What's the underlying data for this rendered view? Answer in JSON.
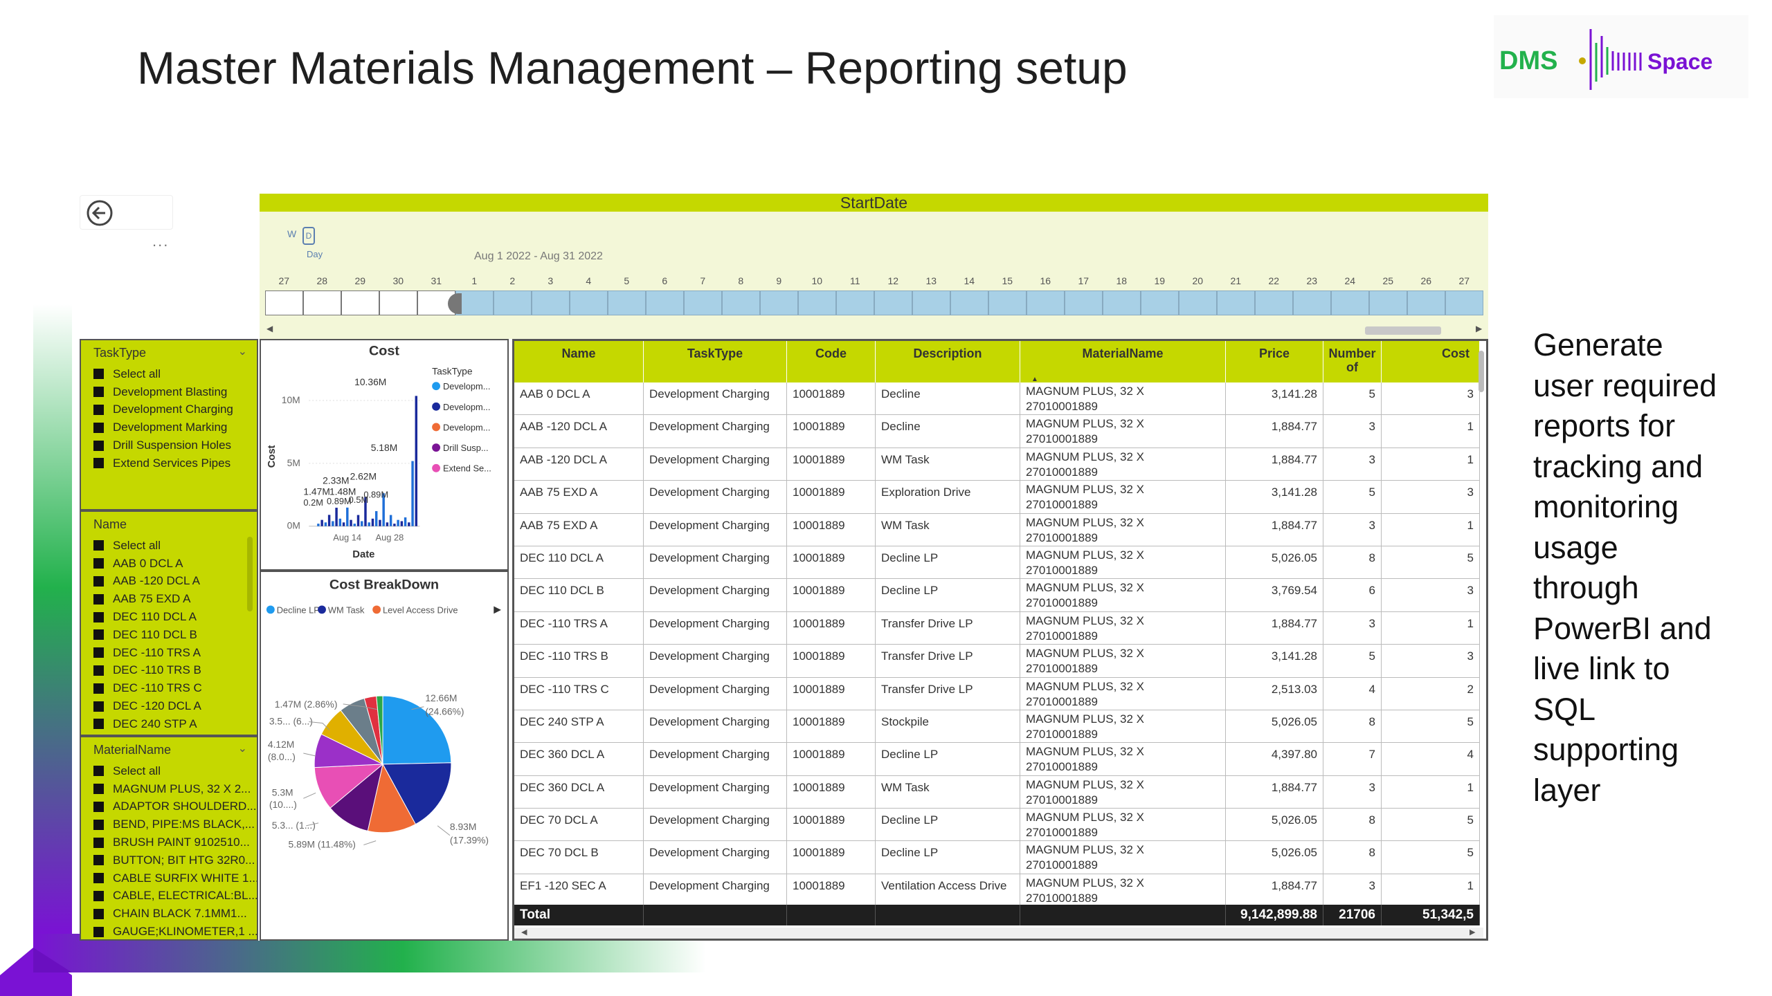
{
  "slide": {
    "title": "Master Materials Management – Reporting setup",
    "logo_dms": "DMS",
    "logo_space": "Space",
    "side_text_lines": [
      "Generate",
      "user required",
      "reports for",
      "tracking and",
      "monitoring",
      "usage",
      "through",
      "PowerBI and",
      "live link to",
      "SQL",
      "supporting",
      "layer"
    ]
  },
  "report": {
    "back_icon": "back-arrow-icon",
    "more_options": "...",
    "timeline": {
      "header": "StartDate",
      "granularity_w": "W",
      "granularity_d": "D",
      "granularity_label": "Day",
      "date_range": "Aug 1 2022 - Aug 31 2022",
      "days": [
        "27",
        "28",
        "29",
        "30",
        "31",
        "1",
        "2",
        "3",
        "4",
        "5",
        "6",
        "7",
        "8",
        "9",
        "10",
        "11",
        "12",
        "13",
        "14",
        "15",
        "16",
        "17",
        "18",
        "19",
        "20",
        "21",
        "22",
        "23",
        "24",
        "25",
        "26",
        "27"
      ],
      "selected_start_index": 5
    },
    "slicers": {
      "tasktype": {
        "title": "TaskType",
        "items": [
          "Select all",
          "Development Blasting",
          "Development Charging",
          "Development Marking",
          "Drill Suspension Holes",
          "Extend Services Pipes"
        ]
      },
      "name": {
        "title": "Name",
        "items": [
          "Select all",
          "AAB 0 DCL A",
          "AAB -120 DCL A",
          "AAB 75 EXD A",
          "DEC 110 DCL A",
          "DEC 110 DCL B",
          "DEC -110 TRS A",
          "DEC -110 TRS B",
          "DEC -110 TRS C",
          "DEC -120 DCL A",
          "DEC 240 STP A"
        ]
      },
      "materialname": {
        "title": "MaterialName",
        "items": [
          "Select all",
          "MAGNUM PLUS, 32 X 2...",
          "ADAPTOR SHOULDERD...",
          "BEND, PIPE:MS BLACK,...",
          "BRUSH PAINT 9102510...",
          "BUTTON; BIT HTG 32R0...",
          "CABLE SURFIX WHITE 1...",
          "CABLE, ELECTRICAL:BL...",
          "CHAIN BLACK 7.1MM1...",
          "GAUGE;KLINOMETER,1 ..."
        ]
      }
    },
    "cost_chart": {
      "title": "Cost",
      "legend_title": "TaskType",
      "legend_items": [
        "Developm...",
        "Developm...",
        "Developm...",
        "Drill Susp...",
        "Extend Se..."
      ],
      "legend_colors": [
        "#1f9bef",
        "#1a2a9c",
        "#ef6b35",
        "#7a1495",
        "#e84fb5"
      ],
      "y_axis_title": "Cost",
      "y_ticks": [
        "10M",
        "5M",
        "0M"
      ],
      "x_axis_title": "Date",
      "x_ticks": [
        "Aug 14",
        "Aug 28"
      ],
      "data_labels": [
        "10.36M",
        "5.18M",
        "2.33M",
        "2.62M",
        "1.47M",
        "1.48M",
        "0.2M",
        "0.89M",
        "0.5M",
        "0.89M"
      ]
    },
    "breakdown_chart": {
      "title": "Cost BreakDown",
      "legend_items": [
        "Decline LP",
        "WM Task",
        "Level Access Drive"
      ],
      "legend_colors": [
        "#1f9bef",
        "#1a2a9c",
        "#ef6b35"
      ],
      "labels": [
        "1.47M (2.86%)",
        "3.5... (6...)",
        "4.12M",
        "(8.0...)",
        "5.3M",
        "(10....)",
        "5.3... (1...)",
        "5.89M (11.48%)",
        "12.66M",
        "(24.66%)",
        "8.93M",
        "(17.39%)"
      ]
    },
    "table": {
      "columns": [
        "Name",
        "TaskType",
        "Code",
        "Description",
        "MaterialName",
        "Price",
        "Number of",
        "Cost"
      ],
      "rows": [
        [
          "AAB 0 DCL A",
          "Development Charging",
          "10001889",
          "Decline",
          "MAGNUM PLUS, 32 X",
          "27010001889",
          "3,141.28",
          "5",
          "3"
        ],
        [
          "AAB -120 DCL A",
          "Development Charging",
          "10001889",
          "Decline",
          "MAGNUM PLUS, 32 X",
          "27010001889",
          "1,884.77",
          "3",
          "1"
        ],
        [
          "AAB -120 DCL A",
          "Development Charging",
          "10001889",
          "WM Task",
          "MAGNUM PLUS, 32 X",
          "27010001889",
          "1,884.77",
          "3",
          "1"
        ],
        [
          "AAB 75 EXD A",
          "Development Charging",
          "10001889",
          "Exploration Drive",
          "MAGNUM PLUS, 32 X",
          "27010001889",
          "3,141.28",
          "5",
          "3"
        ],
        [
          "AAB 75 EXD A",
          "Development Charging",
          "10001889",
          "WM Task",
          "MAGNUM PLUS, 32 X",
          "27010001889",
          "1,884.77",
          "3",
          "1"
        ],
        [
          "DEC 110 DCL A",
          "Development Charging",
          "10001889",
          "Decline LP",
          "MAGNUM PLUS, 32 X",
          "27010001889",
          "5,026.05",
          "8",
          "5"
        ],
        [
          "DEC 110 DCL B",
          "Development Charging",
          "10001889",
          "Decline LP",
          "MAGNUM PLUS, 32 X",
          "27010001889",
          "3,769.54",
          "6",
          "3"
        ],
        [
          "DEC -110 TRS A",
          "Development Charging",
          "10001889",
          "Transfer Drive LP",
          "MAGNUM PLUS, 32 X",
          "27010001889",
          "1,884.77",
          "3",
          "1"
        ],
        [
          "DEC -110 TRS B",
          "Development Charging",
          "10001889",
          "Transfer Drive LP",
          "MAGNUM PLUS, 32 X",
          "27010001889",
          "3,141.28",
          "5",
          "3"
        ],
        [
          "DEC -110 TRS C",
          "Development Charging",
          "10001889",
          "Transfer Drive LP",
          "MAGNUM PLUS, 32 X",
          "27010001889",
          "2,513.03",
          "4",
          "2"
        ],
        [
          "DEC 240 STP A",
          "Development Charging",
          "10001889",
          "Stockpile",
          "MAGNUM PLUS, 32 X",
          "27010001889",
          "5,026.05",
          "8",
          "5"
        ],
        [
          "DEC 360 DCL A",
          "Development Charging",
          "10001889",
          "Decline LP",
          "MAGNUM PLUS, 32 X",
          "27010001889",
          "4,397.80",
          "7",
          "4"
        ],
        [
          "DEC 360 DCL A",
          "Development Charging",
          "10001889",
          "WM Task",
          "MAGNUM PLUS, 32 X",
          "27010001889",
          "1,884.77",
          "3",
          "1"
        ],
        [
          "DEC 70 DCL A",
          "Development Charging",
          "10001889",
          "Decline LP",
          "MAGNUM PLUS, 32 X",
          "27010001889",
          "5,026.05",
          "8",
          "5"
        ],
        [
          "DEC 70 DCL B",
          "Development Charging",
          "10001889",
          "Decline LP",
          "MAGNUM PLUS, 32 X",
          "27010001889",
          "5,026.05",
          "8",
          "5"
        ],
        [
          "EF1 -120 SEC A",
          "Development Charging",
          "10001889",
          "Ventilation Access Drive",
          "MAGNUM PLUS, 32 X",
          "27010001889",
          "1,884.77",
          "3",
          "1"
        ]
      ],
      "total": {
        "label": "Total",
        "price": "9,142,899.88",
        "number": "21706",
        "cost": "51,342,5"
      }
    }
  },
  "colors": {
    "accent_lime": "#c5d800",
    "timeline_bg": "#f3f7d8",
    "total_bg": "#1f1f1f",
    "deco_purple": "#7a12d4",
    "deco_green": "#22b14c"
  }
}
